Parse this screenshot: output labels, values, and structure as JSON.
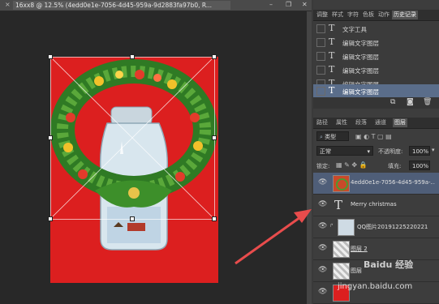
{
  "document": {
    "tab_title": "16xx8 @ 12.5% (4edd0e1e-7056-4d45-959a-9d2883fa97b0, R...",
    "close_glyph": "×"
  },
  "window_controls": {
    "minimize": "–",
    "restore": "❐",
    "close": "✕"
  },
  "history_panel": {
    "tabs": [
      "调整",
      "样式",
      "字符",
      "色板",
      "动作",
      "历史记录"
    ],
    "active_tab": "历史记录",
    "items": [
      {
        "label": "文字工具",
        "active": false
      },
      {
        "label": "编辑文字图层",
        "active": false
      },
      {
        "label": "编辑文字图层",
        "active": false
      },
      {
        "label": "编辑文字图层",
        "active": false
      },
      {
        "label": "编辑文字图层",
        "active": false
      },
      {
        "label": "编辑文字图层",
        "active": true
      }
    ],
    "type_glyph": "T"
  },
  "layers_panel": {
    "tabs": [
      "路径",
      "属性",
      "段落",
      "通道",
      "图层"
    ],
    "active_tab": "图层",
    "filter_value": "类型",
    "blend_mode": "正常",
    "opacity_label": "不透明度:",
    "opacity_value": "100%",
    "lock_label": "锁定:",
    "fill_label": "填充:",
    "fill_value": "100%",
    "layers": [
      {
        "name": "4edd0e1e-7056-4d45-959a-...",
        "kind": "smart",
        "active": true
      },
      {
        "name": "Merry christmas",
        "kind": "text",
        "active": false
      },
      {
        "name": "QQ图片20191225220221",
        "kind": "image",
        "active": false
      },
      {
        "name": "图层 2",
        "kind": "pixel",
        "active": false
      },
      {
        "name": "图层",
        "kind": "pixel",
        "active": false
      },
      {
        "name": "",
        "kind": "red",
        "active": false
      }
    ]
  },
  "watermark": {
    "text": "jingyan.baidu.com",
    "brand": "Baidu 经验"
  },
  "colors": {
    "canvas_bg": "#dc1f1f",
    "selection": "#5a6d8a",
    "arrow": "#e84c4c"
  }
}
